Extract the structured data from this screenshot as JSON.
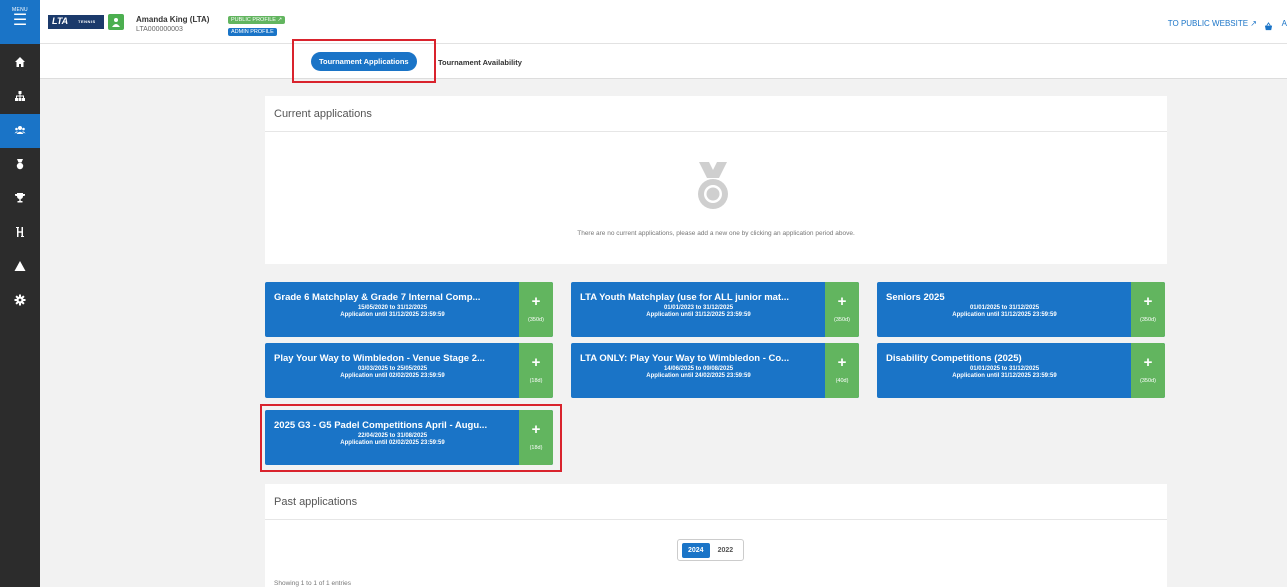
{
  "sidebar": {
    "menu_label": "MENU",
    "items": [
      {
        "icon": "home-icon",
        "symbol": "⌂"
      },
      {
        "icon": "sitemap-icon",
        "symbol": "⊞"
      },
      {
        "icon": "users-icon",
        "symbol": "👥",
        "active": true
      },
      {
        "icon": "medal-icon",
        "symbol": "◈"
      },
      {
        "icon": "trophy-icon",
        "symbol": "🏆"
      },
      {
        "icon": "bracket-icon",
        "symbol": "H"
      },
      {
        "icon": "warning-icon",
        "symbol": "▲"
      },
      {
        "icon": "gear-icon",
        "symbol": "⚙"
      }
    ]
  },
  "header": {
    "logo_text": "LTA",
    "logo_sub": "TENNIS",
    "user_name": "Amanda King (LTA)",
    "user_id": "LTA000000003",
    "public_profile": "PUBLIC PROFILE ↗",
    "admin_profile": "ADMIN PROFILE",
    "public_website": "TO PUBLIC WEBSITE ↗",
    "cut_text": "A"
  },
  "tabs": {
    "active": "Tournament Applications",
    "other": "Tournament Availability"
  },
  "current_panel": {
    "title": "Current applications",
    "empty_text": "There are no current applications, please add a new one by clicking an application period above."
  },
  "periods": [
    {
      "title": "Grade 6 Matchplay & Grade 7 Internal Comp...",
      "dates": "15/05/2020 to 31/12/2025",
      "until": "Application until 31/12/2025 23:59:59",
      "days": "(350d)"
    },
    {
      "title": "LTA Youth Matchplay (use for ALL junior mat...",
      "dates": "01/01/2023 to 31/12/2025",
      "until": "Application until 31/12/2025 23:59:59",
      "days": "(350d)"
    },
    {
      "title": "Seniors 2025",
      "dates": "01/01/2025 to 31/12/2025",
      "until": "Application until 31/12/2025 23:59:59",
      "days": "(350d)"
    },
    {
      "title": "Play Your Way to Wimbledon - Venue Stage 2...",
      "dates": "03/03/2025 to 25/05/2025",
      "until": "Application until 02/02/2025 23:59:59",
      "days": "(18d)"
    },
    {
      "title": "LTA ONLY: Play Your Way to Wimbledon - Co...",
      "dates": "14/06/2025 to 09/08/2025",
      "until": "Application until 24/02/2025 23:59:59",
      "days": "(40d)"
    },
    {
      "title": "Disability Competitions (2025)",
      "dates": "01/01/2025 to 31/12/2025",
      "until": "Application until 31/12/2025 23:59:59",
      "days": "(350d)"
    },
    {
      "title": "2025 G3 - G5 Padel Competitions April - Augu...",
      "dates": "22/04/2025 to 31/08/2025",
      "until": "Application until 02/02/2025 23:59:59",
      "days": "(18d)"
    }
  ],
  "past_panel": {
    "title": "Past applications",
    "years": [
      "2024",
      "2022"
    ],
    "active_year": "2024",
    "showing": "Showing 1 to 1 of 1 entries"
  },
  "colors": {
    "primary": "#1a74c7",
    "green": "#62b55f",
    "sidebar": "#2c2c2c",
    "highlight": "#d9232d"
  }
}
